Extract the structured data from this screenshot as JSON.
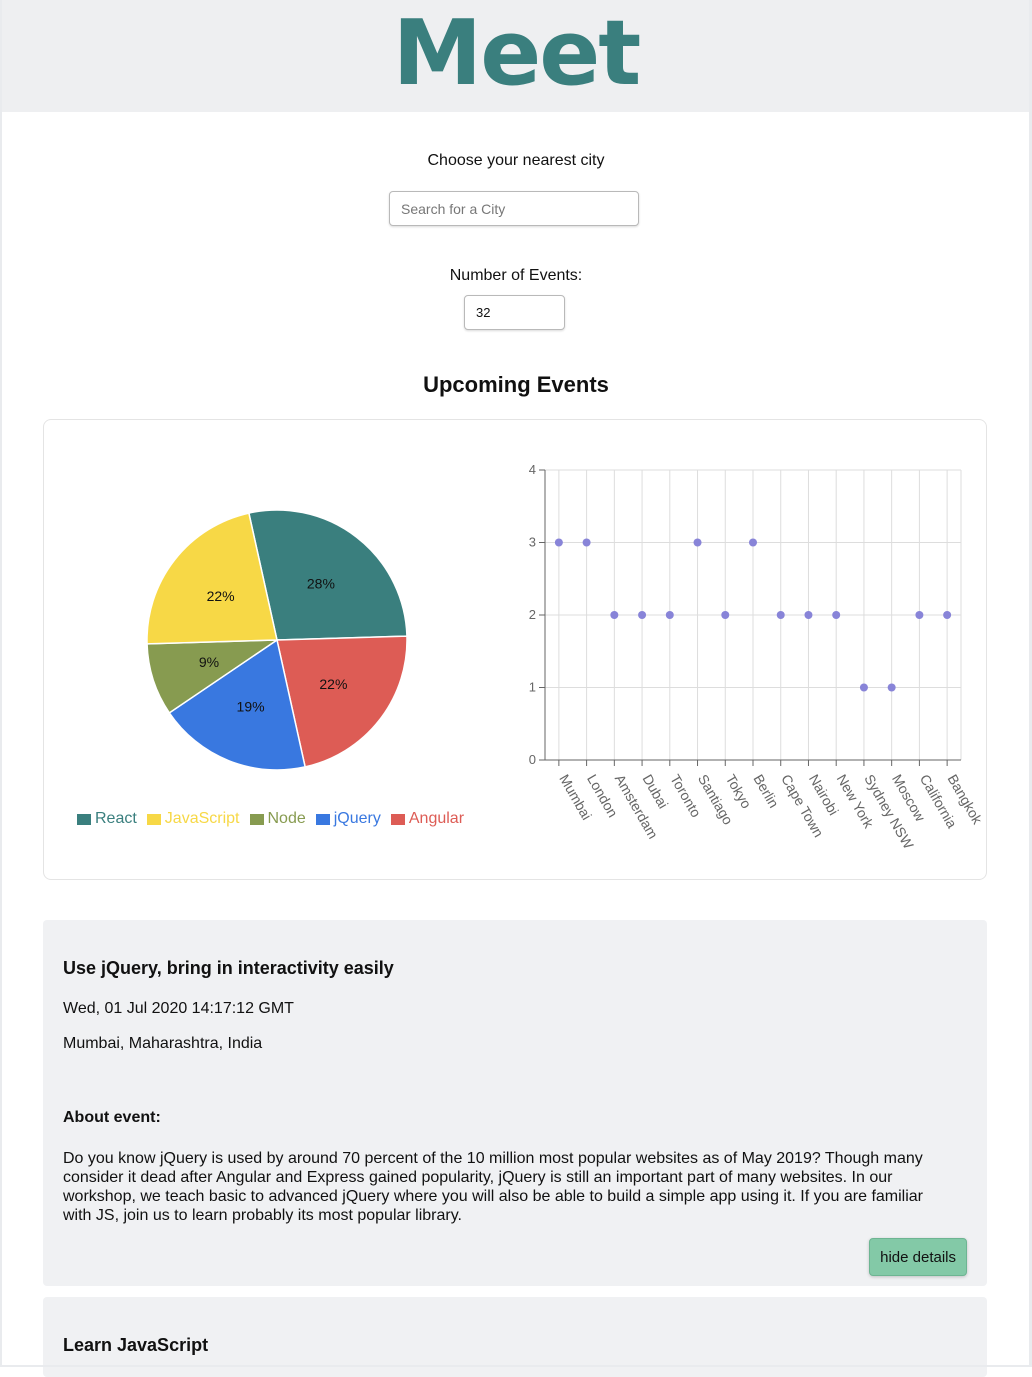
{
  "app": {
    "title": "Meet"
  },
  "search": {
    "label": "Choose your nearest city",
    "placeholder": "Search for a City",
    "value": ""
  },
  "events_count": {
    "label": "Number of Events:",
    "value": "32"
  },
  "section_title": "Upcoming Events",
  "colors": {
    "brand": "#3a7f7e",
    "button": "#83c9a7",
    "scatter_point": "#8884d8"
  },
  "chart_data": [
    {
      "type": "pie",
      "slices": [
        {
          "label": "React",
          "value": 28,
          "color": "#3a7f7e"
        },
        {
          "label": "Angular",
          "value": 22,
          "color": "#dd5c55"
        },
        {
          "label": "jQuery",
          "value": 19,
          "color": "#3978e0"
        },
        {
          "label": "Node",
          "value": 9,
          "color": "#879b50"
        },
        {
          "label": "JavaScript",
          "value": 22,
          "color": "#f7d846"
        }
      ],
      "legend_order": [
        "React",
        "JavaScript",
        "Node",
        "jQuery",
        "Angular"
      ],
      "legend_position": "bottom"
    },
    {
      "type": "scatter",
      "categories": [
        "Mumbai",
        "London",
        "Amsterdam",
        "Dubai",
        "Toronto",
        "Santiago",
        "Tokyo",
        "Berlin",
        "Cape Town",
        "Nairobi",
        "New York",
        "Sydney NSW",
        "Moscow",
        "California",
        "Bangkok"
      ],
      "values": [
        3,
        3,
        2,
        2,
        2,
        3,
        2,
        3,
        2,
        2,
        2,
        1,
        1,
        2,
        2
      ],
      "yticks": [
        0,
        1,
        2,
        3,
        4
      ],
      "ylim": [
        0,
        4
      ],
      "grid": true
    }
  ],
  "events": [
    {
      "title": "Use jQuery, bring in interactivity easily",
      "date": "Wed, 01 Jul 2020 14:17:12 GMT",
      "location": "Mumbai, Maharashtra, India",
      "about_label": "About event:",
      "description": "Do you know jQuery is used by around 70 percent of the 10 million most popular websites as of May 2019? Though many consider it dead after Angular and Express gained popularity, jQuery is still an important part of many websites. In our workshop, we teach basic to advanced jQuery where you will also be able to build a simple app using it. If you are familiar with JS, join us to learn probably its most popular library.",
      "button_label": "hide details"
    },
    {
      "title": "Learn JavaScript"
    }
  ]
}
